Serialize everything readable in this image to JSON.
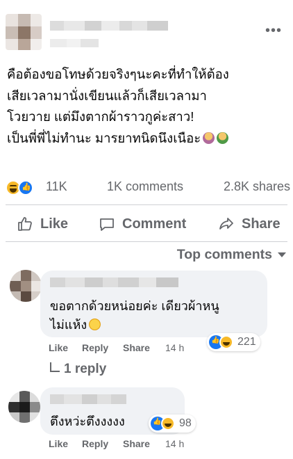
{
  "post": {
    "author_name": "",
    "more_label": "•••",
    "text_lines": [
      "คือต้องขอโทษด้วยจริงๆนะคะที่ทำให้ต้อง",
      "เสียเวลามานั่งเขียนแล้วก็เสียเวลามา",
      "โวยวาย แต่มึงตากผ้าราวกูค่ะสาว!",
      "เป็นพี่พี่ไม่ทำนะ มารยาทนิดนึงเนือะ"
    ],
    "inline_emojis": [
      "person-facepalming-emoji",
      "person-shrugging-emoji"
    ]
  },
  "stats": {
    "reactions": "11K",
    "comments": "1K comments",
    "shares": "2.8K shares"
  },
  "actions": {
    "like": "Like",
    "comment": "Comment",
    "share": "Share"
  },
  "comments_header": {
    "sort_label": "Top comments"
  },
  "comments": [
    {
      "author": "",
      "text_lines": [
        "ขอตากด้วยหน่อยค่ะ เดียวผ้าหนู",
        "ไม่แห้ง"
      ],
      "inline_emoji": "rolling-laughing-emoji",
      "like_label": "Like",
      "reply_label": "Reply",
      "share_label": "Share",
      "time": "14 h",
      "reaction_count": "221",
      "replies_label": "1 reply"
    },
    {
      "author": "",
      "text_lines": [
        "ตึงหว่ะตึงงงงง"
      ],
      "like_label": "Like",
      "reply_label": "Reply",
      "share_label": "Share",
      "time": "14 h",
      "reaction_count": "98"
    }
  ],
  "colors": {
    "text": "#050505",
    "secondary": "#65676b",
    "bubble": "#f0f2f5",
    "divider": "#ced0d4",
    "like_blue": "#1877f2",
    "haha_yellow": "#f7b928"
  }
}
